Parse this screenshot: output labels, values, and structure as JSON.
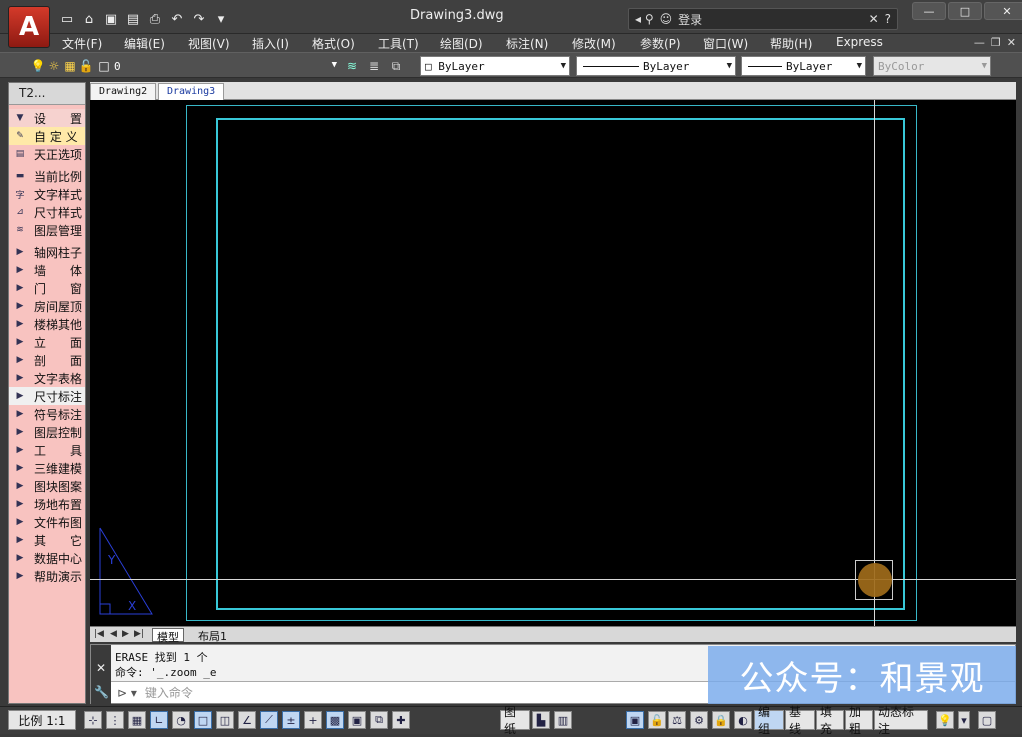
{
  "window": {
    "title": "Drawing3.dwg",
    "login": "登录"
  },
  "menu": [
    "文件(F)",
    "编辑(E)",
    "视图(V)",
    "插入(I)",
    "格式(O)",
    "工具(T)",
    "绘图(D)",
    "标注(N)",
    "修改(M)",
    "参数(P)",
    "窗口(W)",
    "帮助(H)",
    "Express"
  ],
  "toolbar": {
    "layer": "0",
    "color": "ByLayer",
    "linetype": "ByLayer",
    "lineweight": "ByLayer",
    "plotstyle": "ByColor"
  },
  "panel": {
    "title": "T2...",
    "items": [
      {
        "label": "设　　置",
        "icon": "triangle-down",
        "style": "hdr"
      },
      {
        "label": "自 定 义",
        "icon": "brush",
        "style": "hl"
      },
      {
        "label": "天正选项",
        "icon": "options",
        "style": ""
      },
      {
        "label": "当前比例",
        "icon": "scale",
        "style": ""
      },
      {
        "label": "文字样式",
        "icon": "text-style",
        "style": ""
      },
      {
        "label": "尺寸样式",
        "icon": "dim-style",
        "style": ""
      },
      {
        "label": "图层管理",
        "icon": "layers",
        "style": ""
      },
      {
        "label": "轴网柱子",
        "icon": "triangle-right",
        "style": ""
      },
      {
        "label": "墙　　体",
        "icon": "triangle-right",
        "style": ""
      },
      {
        "label": "门　　窗",
        "icon": "triangle-right",
        "style": ""
      },
      {
        "label": "房间屋顶",
        "icon": "triangle-right",
        "style": ""
      },
      {
        "label": "楼梯其他",
        "icon": "triangle-right",
        "style": ""
      },
      {
        "label": "立　　面",
        "icon": "triangle-right",
        "style": ""
      },
      {
        "label": "剖　　面",
        "icon": "triangle-right",
        "style": ""
      },
      {
        "label": "文字表格",
        "icon": "triangle-right",
        "style": ""
      },
      {
        "label": "尺寸标注",
        "icon": "triangle-right",
        "style": "sel"
      },
      {
        "label": "符号标注",
        "icon": "triangle-right",
        "style": ""
      },
      {
        "label": "图层控制",
        "icon": "triangle-right",
        "style": ""
      },
      {
        "label": "工　　具",
        "icon": "triangle-right",
        "style": ""
      },
      {
        "label": "三维建模",
        "icon": "triangle-right",
        "style": ""
      },
      {
        "label": "图块图案",
        "icon": "triangle-right",
        "style": ""
      },
      {
        "label": "场地布置",
        "icon": "triangle-right",
        "style": ""
      },
      {
        "label": "文件布图",
        "icon": "triangle-right",
        "style": ""
      },
      {
        "label": "其　　它",
        "icon": "triangle-right",
        "style": ""
      },
      {
        "label": "数据中心",
        "icon": "triangle-right",
        "style": ""
      },
      {
        "label": "帮助演示",
        "icon": "triangle-right",
        "style": ""
      }
    ]
  },
  "tabs": [
    "Drawing2",
    "Drawing3"
  ],
  "layout_tabs": [
    "模型",
    "布局1"
  ],
  "command": {
    "line1": "ERASE 找到 1 个",
    "line2": "命令: '_.zoom _e",
    "placeholder": "键入命令"
  },
  "watermark": "公众号：和景观",
  "status": {
    "scale": "比例 1:1",
    "paper": "图纸",
    "toggles": [
      "编组",
      "基线",
      "填充",
      "加粗",
      "动态标注"
    ]
  }
}
